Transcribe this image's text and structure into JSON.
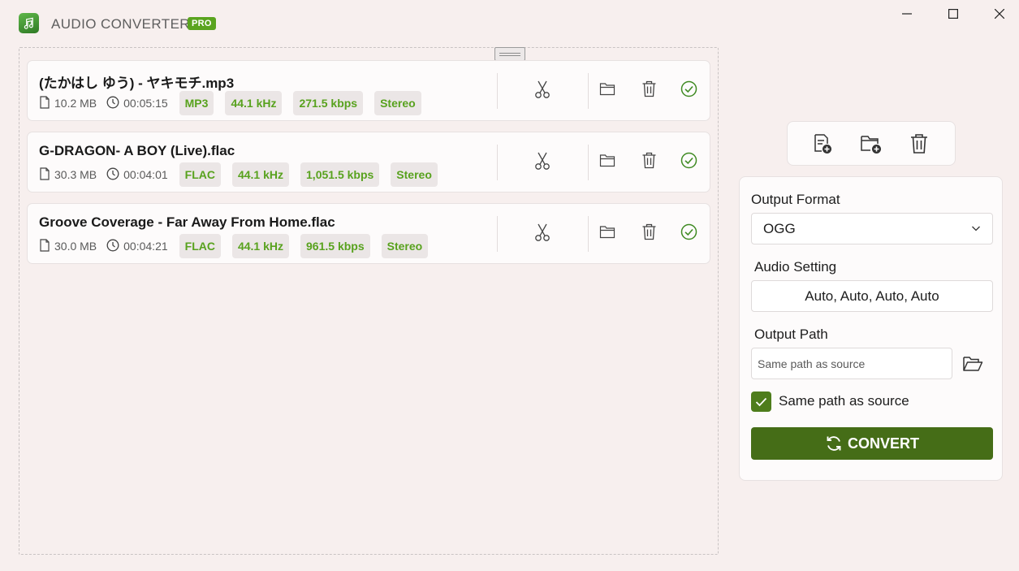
{
  "app": {
    "title": "AUDIO CONVERTER",
    "badge": "PRO",
    "accent_color": "#5aa41f",
    "convert_color": "#456d17"
  },
  "window_controls": [
    "minimize-icon",
    "maximize-icon",
    "close-icon"
  ],
  "files": [
    {
      "name": "(たかはし ゆう) - ヤキモチ.mp3",
      "size": "10.2 MB",
      "duration": "00:05:15",
      "format": "MP3",
      "sample_rate": "44.1 kHz",
      "bitrate": "271.5 kbps",
      "channels": "Stereo"
    },
    {
      "name": "G-DRAGON- A BOY (Live).flac",
      "size": "30.3 MB",
      "duration": "00:04:01",
      "format": "FLAC",
      "sample_rate": "44.1 kHz",
      "bitrate": "1,051.5 kbps",
      "channels": "Stereo"
    },
    {
      "name": "Groove Coverage - Far Away From Home.flac",
      "size": "30.0 MB",
      "duration": "00:04:21",
      "format": "FLAC",
      "sample_rate": "44.1 kHz",
      "bitrate": "961.5 kbps",
      "channels": "Stereo"
    }
  ],
  "file_actions": [
    "scissors-icon",
    "folder-icon",
    "trash-icon",
    "check-circle-icon"
  ],
  "toolbar": [
    "add-file-icon",
    "add-folder-icon",
    "trash-icon"
  ],
  "settings": {
    "output_format_label": "Output Format",
    "output_format_value": "OGG",
    "audio_setting_label": "Audio Setting",
    "audio_setting_value": "Auto, Auto, Auto, Auto",
    "output_path_label": "Output Path",
    "output_path_placeholder": "Same path as source",
    "same_path_checked": true,
    "same_path_label": "Same path as source",
    "convert_label": "CONVERT"
  }
}
